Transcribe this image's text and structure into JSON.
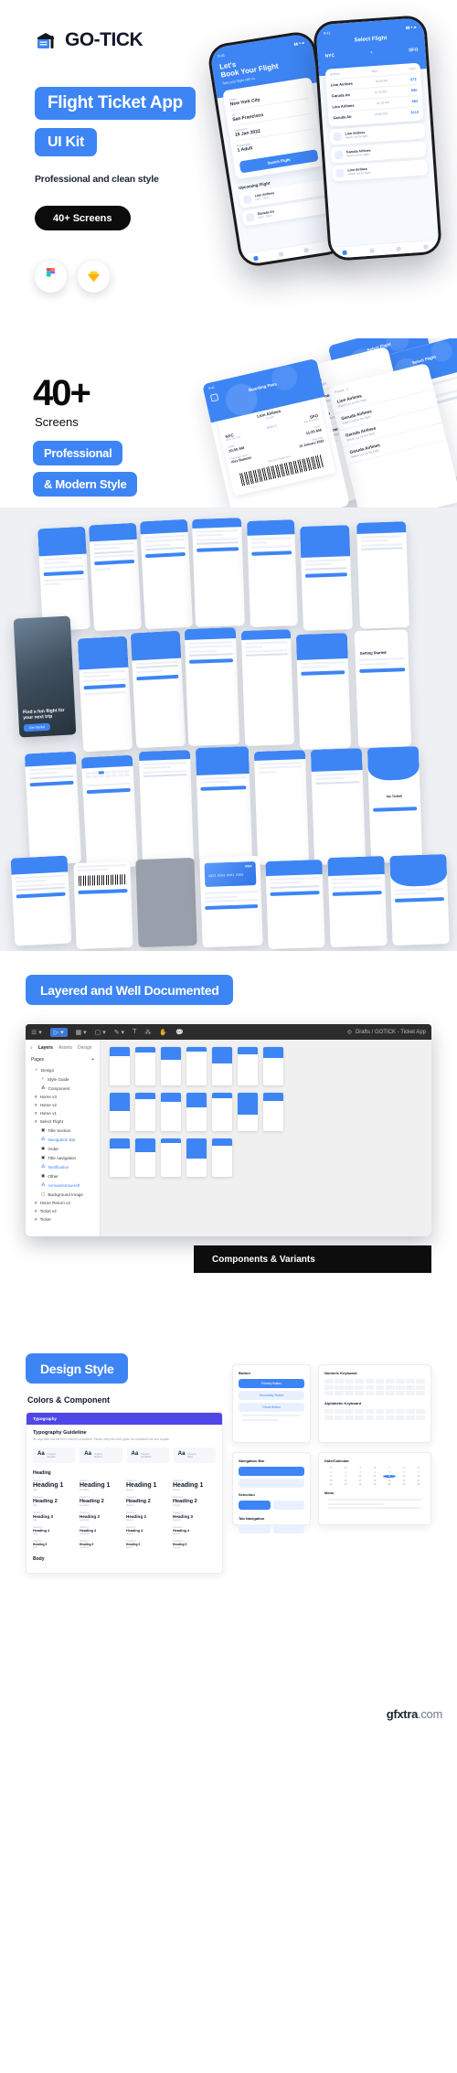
{
  "brand": {
    "name": "GO-TICK",
    "logo_icon": "ticket-gate-icon"
  },
  "hero": {
    "title": "Flight Ticket App",
    "subtitle": "UI Kit",
    "tagline": "Professional and clean style",
    "badge": "40+ Screens",
    "tools": [
      {
        "name": "figma-icon",
        "label": "Figma"
      },
      {
        "name": "sketch-icon",
        "label": "Sketch"
      }
    ],
    "accent_color": "#3d85f5",
    "dark_color": "#0c0c0c",
    "phone_a": {
      "time": "9:41",
      "heading": "Let's\nBook Your Flight",
      "sub": "Take your flight with us",
      "fields": [
        {
          "label": "From",
          "value": "New York City"
        },
        {
          "label": "To",
          "value": "San Francisco"
        },
        {
          "label": "Departure",
          "value": "15 Jan 2022"
        },
        {
          "label": "Passenger",
          "value": "1 Adult"
        }
      ],
      "cta": "Search Flight",
      "section": "Upcoming Flight",
      "list": [
        {
          "title": "Lion Airlines",
          "sub": "NYC - SFO"
        },
        {
          "title": "Garuda Airlines",
          "sub": "NYC - SFO"
        }
      ]
    },
    "phone_b": {
      "time": "9:41",
      "heading": "Select Flight",
      "price": "$72",
      "rows": [
        {
          "name": "Lion Airlines",
          "time": "10:00 AM",
          "price": "$72"
        },
        {
          "name": "Garuda Airlines",
          "time": "11:30 AM",
          "price": "$90"
        },
        {
          "name": "Lion Airlines",
          "time": "01:15 PM",
          "price": "$84"
        },
        {
          "name": "Garuda Airlines",
          "time": "04:40 PM",
          "price": "$112"
        }
      ]
    }
  },
  "screens_section": {
    "number": "40+",
    "label": "Screens",
    "pill_one": "Professional",
    "pill_two": "& Modern Style",
    "boarding_pass": {
      "time": "9:41",
      "title": "Boarding Pass",
      "airline": "Lion Airlines",
      "flight_code": "A4-343",
      "from_code": "NYC",
      "from_city": "New York City",
      "to_code": "SFO",
      "to_city": "San Francisco",
      "duration": "5h45m",
      "depart_label": "Depart",
      "depart_time": "10:00 AM",
      "arrive_label": "Arrive",
      "arrive_time": "11:25 AM",
      "passenger_label": "Passenger Name",
      "passenger_name": "Alex Baletski",
      "flight_date_label": "Flight Date",
      "flight_date": "15 January 2022",
      "submit_note": "Submit on Registration"
    },
    "airline_list": {
      "header": "Found - 2",
      "rows": [
        {
          "name": "Lion Airlines",
          "sub": "Watch out for the flight",
          "price": "$72.00"
        },
        {
          "name": "Garuda Airlines",
          "sub": "Watch out for the flight",
          "price": "$90.00"
        },
        {
          "name": "Lion Airlines",
          "sub": "Watch out for the flight",
          "price": "$84.00"
        },
        {
          "name": "Garuda Airlines",
          "sub": "Watch out for the flight",
          "price": "$112.00"
        },
        {
          "name": "Garuda Airlines",
          "sub": "Watch out for the flight",
          "price": "$134.00"
        }
      ]
    },
    "select_flight_title": "Select Flight"
  },
  "grid_section": {
    "background": "#eef0f4",
    "hero_card": {
      "title": "Find a fun flight for\nyour next trip",
      "cta": "Get Started"
    },
    "card_title": "VISA",
    "card_number": "3822 8283 8281 2386",
    "card_holder": "Albert Steinfeld (Sajida)",
    "card_valid": "12/26",
    "no_ticket": "No Ticket!",
    "getting_started": "Getting Started",
    "download_ticket": "Download Ticket"
  },
  "layered": {
    "banner": "Layered and Well Documented",
    "figma": {
      "file_breadcrumb": "Drafts  /  GOTICK - Ticket App",
      "toolbar_icons": [
        "menu-icon",
        "cursor-icon",
        "frame-icon",
        "shape-icon",
        "pen-icon",
        "text-icon",
        "component-icon",
        "hand-icon",
        "comment-icon"
      ],
      "panel_tabs": [
        "Layers",
        "Assets",
        "Design"
      ],
      "pages_label": "Pages",
      "pages": [
        "Design",
        "Style Guide",
        "Component"
      ],
      "layers": [
        "Home v3",
        "Home v2",
        "Home v1",
        "Select Flight",
        "Title Section",
        "Navigation Bar",
        "Order",
        "Title navigation",
        "Notification",
        "Other",
        "Arrows/arrow-left",
        "Background Image",
        "Home Return v2",
        "Ticket v2",
        "Ticket"
      ]
    },
    "components_banner": "Components & Variants"
  },
  "design_style": {
    "title": "Design Style",
    "subtitle": "Colors & Component",
    "typography_tag": "Typography",
    "guideline_title": "Typography Guideline",
    "guideline_text": "It's important that we fit it's element consistent. Please obey the rules guide for consistent use and explain.",
    "fonts": [
      {
        "sample": "Aa",
        "name": "Poppins",
        "weight": "Regular"
      },
      {
        "sample": "Aa",
        "name": "Poppins",
        "weight": "Medium"
      },
      {
        "sample": "Aa",
        "name": "Poppins",
        "weight": "SemiBold"
      },
      {
        "sample": "Aa",
        "name": "Poppins",
        "weight": "Bold"
      }
    ],
    "heading_label": "Heading",
    "body_label": "Body",
    "headings": [
      {
        "tag": "Heading 1",
        "sample": "Heading 1",
        "meta": "32px"
      },
      {
        "tag": "Heading 1",
        "sample": "Heading 1",
        "meta": "SemiBold"
      },
      {
        "tag": "Heading 1",
        "sample": "Heading 1",
        "meta": "Medium"
      },
      {
        "tag": "Heading 1",
        "sample": "Heading 1",
        "meta": "Regular"
      },
      {
        "tag": "Heading 2",
        "sample": "Heading 2",
        "meta": "28px"
      },
      {
        "tag": "Heading 2",
        "sample": "Heading 2",
        "meta": "SemiBold"
      },
      {
        "tag": "Heading 2",
        "sample": "Heading 2",
        "meta": "Medium"
      },
      {
        "tag": "Heading 2",
        "sample": "Heading 2",
        "meta": "Regular"
      },
      {
        "tag": "Heading 3",
        "sample": "Heading 3",
        "meta": "24px"
      },
      {
        "tag": "Heading 3",
        "sample": "Heading 3",
        "meta": "SemiBold"
      },
      {
        "tag": "Heading 3",
        "sample": "Heading 3",
        "meta": "Medium"
      },
      {
        "tag": "Heading 3",
        "sample": "Heading 3",
        "meta": "Regular"
      },
      {
        "tag": "Heading 4",
        "sample": "Heading 4",
        "meta": "20px"
      },
      {
        "tag": "Heading 4",
        "sample": "Heading 4",
        "meta": "SemiBold"
      },
      {
        "tag": "Heading 4",
        "sample": "Heading 4",
        "meta": "Medium"
      },
      {
        "tag": "Heading 4",
        "sample": "Heading 4",
        "meta": "Regular"
      },
      {
        "tag": "Heading 5",
        "sample": "Heading 5",
        "meta": "18px"
      },
      {
        "tag": "Heading 5",
        "sample": "Heading 5",
        "meta": "SemiBold"
      },
      {
        "tag": "Heading 5",
        "sample": "Heading 5",
        "meta": "Medium"
      },
      {
        "tag": "Heading 5",
        "sample": "Heading 5",
        "meta": "Regular"
      }
    ],
    "components": {
      "button_label": "Button",
      "buttons": [
        "Primary Button",
        "Secondary Button",
        "Ghost Button"
      ],
      "keyboard_label": "Numeric Keyboard",
      "alphabet_label": "Alphabetic Keyboard",
      "navigation_label": "Navigation Bar",
      "selection_label": "Selection",
      "tab_label": "Tab Navigation",
      "calendar_label": "Date/Calendar",
      "menu_label": "Menu"
    }
  },
  "watermark": {
    "bold": "gfxtra",
    "light": ".com"
  }
}
